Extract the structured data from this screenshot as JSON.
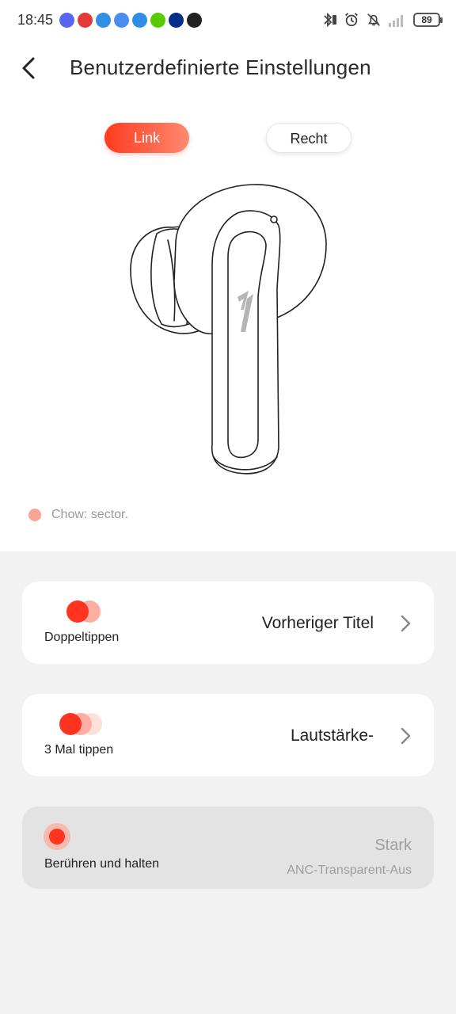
{
  "status_bar": {
    "time": "18:45",
    "battery": "89",
    "notification_icons": [
      {
        "name": "discord-icon",
        "color": "#5865F2"
      },
      {
        "name": "heart-app-icon",
        "color": "#e53935"
      },
      {
        "name": "puzzle-app-icon",
        "color": "#2f8ee5"
      },
      {
        "name": "gmail-icon",
        "color": "#4a8cf0"
      },
      {
        "name": "warning-icon",
        "color": "#2f8ee5"
      },
      {
        "name": "duolingo-icon",
        "color": "#58cc02"
      },
      {
        "name": "paypal-icon",
        "color": "#003087"
      },
      {
        "name": "camera-app-icon",
        "color": "#222222"
      }
    ]
  },
  "header": {
    "title": "Benutzerdefinierte Einstellungen"
  },
  "side_toggle": {
    "left_label": "Link",
    "right_label": "Recht",
    "selected": "left"
  },
  "legend": {
    "text": "Chow: sector."
  },
  "gestures": [
    {
      "label": "Doppeltippen",
      "value": "Vorheriger Titel"
    },
    {
      "label": "3 Mal tippen",
      "value": "Lautstärke-"
    },
    {
      "label": "Berühren und halten",
      "value": "Stark",
      "subvalue": "ANC-Transparent-Aus"
    }
  ],
  "colors": {
    "accent": "#ff3420",
    "accent_light": "#fdaea2"
  }
}
